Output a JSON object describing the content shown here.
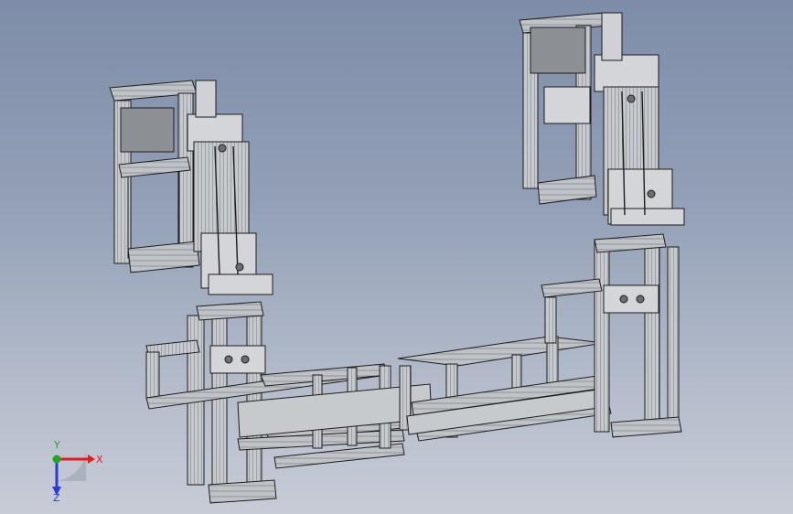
{
  "viewport": {
    "background_top": "#7d8ca8",
    "background_bottom": "#c7ccd6",
    "model_color": "#b9bcc0",
    "model_edge_color": "#1a1a1a"
  },
  "triad": {
    "x_label": "X",
    "y_label": "Y",
    "z_label": "Z",
    "x_color": "#e0201e",
    "y_color": "#21a621",
    "z_color": "#2a3fd0"
  }
}
